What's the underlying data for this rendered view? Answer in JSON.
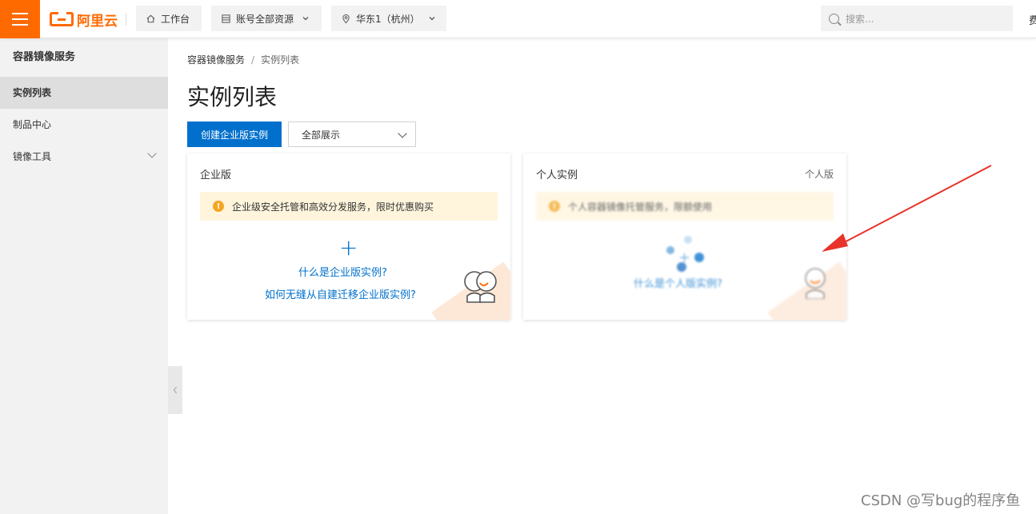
{
  "topbar": {
    "logo_text": "阿里云",
    "workbench_label": "工作台",
    "resources_label": "账号全部资源",
    "region_label": "华东1（杭州）",
    "search_placeholder": "搜索...",
    "right_cut_text": "费"
  },
  "sidebar": {
    "title": "容器镜像服务",
    "items": [
      {
        "label": "实例列表",
        "active": true
      },
      {
        "label": "制品中心",
        "active": false
      },
      {
        "label": "镜像工具",
        "active": false,
        "expandable": true
      }
    ]
  },
  "main": {
    "breadcrumb": [
      "容器镜像服务",
      "实例列表"
    ],
    "breadcrumb_sep": "/",
    "title": "实例列表",
    "create_button": "创建企业版实例",
    "filter_select": "全部展示",
    "cards": [
      {
        "title": "企业版",
        "notice": "企业级安全托管和高效分发服务，限时优惠购买",
        "plus": "+",
        "links": [
          "什么是企业版实例?",
          "如何无缝从自建迁移企业版实例?"
        ]
      },
      {
        "title": "个人实例",
        "tag": "个人版",
        "notice": "个人容器镜像托管服务，限额使用",
        "links": [
          "什么是个人版实例?"
        ]
      }
    ]
  },
  "watermark": "CSDN @写bug的程序鱼",
  "colors": {
    "brand_orange": "#ff6a00",
    "primary_blue": "#0070cc",
    "notice_bg": "#fff5dc",
    "annotation_red": "#e8332a"
  }
}
